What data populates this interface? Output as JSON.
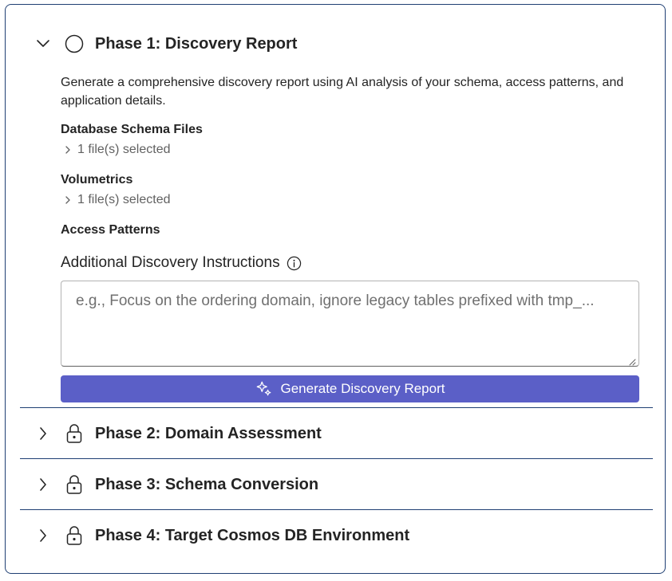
{
  "phases": [
    {
      "title": "Phase 1: Discovery Report",
      "state": "expanded",
      "status_icon": "circle-icon"
    },
    {
      "title": "Phase 2: Domain Assessment",
      "state": "collapsed",
      "status_icon": "lock-icon"
    },
    {
      "title": "Phase 3: Schema Conversion",
      "state": "collapsed",
      "status_icon": "lock-icon"
    },
    {
      "title": "Phase 4: Target Cosmos DB Environment",
      "state": "collapsed",
      "status_icon": "lock-icon"
    }
  ],
  "phase1": {
    "description": "Generate a comprehensive discovery report using AI analysis of your schema, access patterns, and application details.",
    "schema_files": {
      "label": "Database Schema Files",
      "selection": "1 file(s) selected"
    },
    "volumetrics": {
      "label": "Volumetrics",
      "selection": "1 file(s) selected"
    },
    "access_patterns": {
      "label": "Access Patterns"
    },
    "instructions": {
      "label": "Additional Discovery Instructions",
      "placeholder": "e.g., Focus on the ordering domain, ignore legacy tables prefixed with tmp_...",
      "value": ""
    },
    "generate_button": {
      "label": "Generate Discovery Report",
      "icon": "sparkle-icon"
    }
  },
  "colors": {
    "border": "#1f3f73",
    "primary_button": "#5b5fc7",
    "text": "#242424",
    "muted_text": "#616161"
  }
}
